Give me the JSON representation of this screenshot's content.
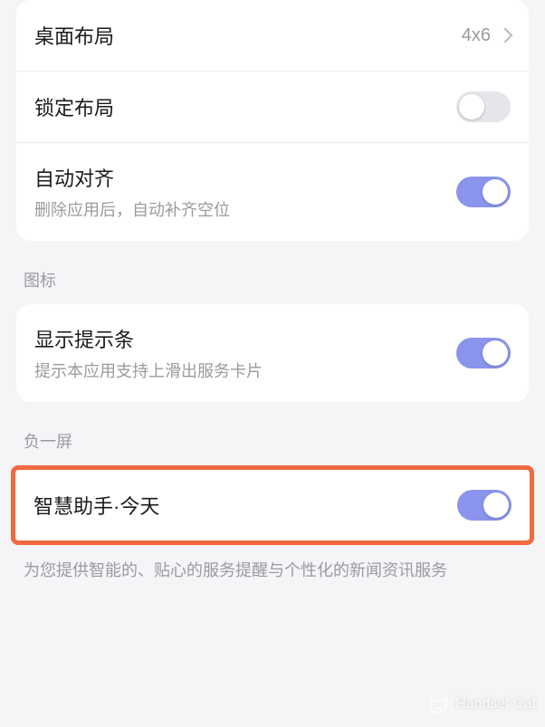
{
  "group1": {
    "desktop_layout": {
      "title": "桌面布局",
      "value": "4x6"
    },
    "lock_layout": {
      "title": "锁定布局",
      "on": false
    },
    "auto_align": {
      "title": "自动对齐",
      "sub": "删除应用后，自动补齐空位",
      "on": true
    }
  },
  "icons_section": {
    "header": "图标",
    "show_hint_bar": {
      "title": "显示提示条",
      "sub": "提示本应用支持上滑出服务卡片",
      "on": true
    }
  },
  "minus_one_section": {
    "header": "负一屏",
    "smart_assistant": {
      "title": "智慧助手·今天",
      "on": true
    },
    "desc": "为您提供智能的、贴心的服务提醒与个性化的新闻资讯服务"
  },
  "watermark": "Handset Cat"
}
